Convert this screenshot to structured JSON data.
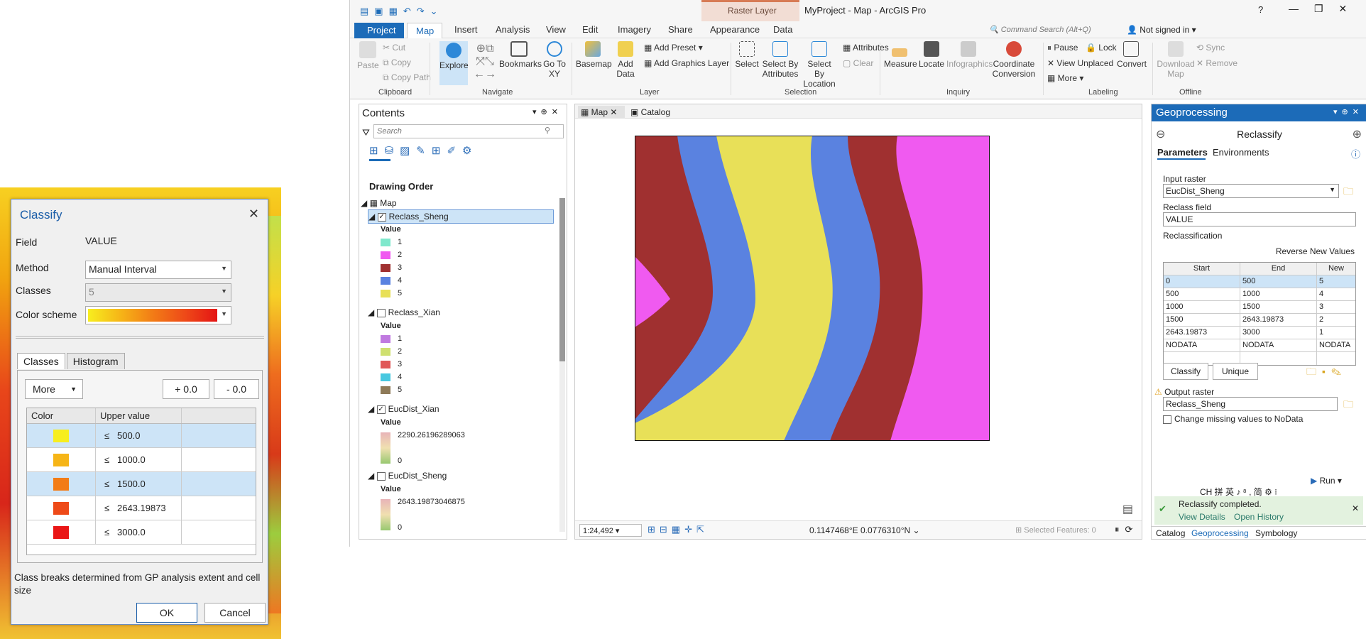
{
  "classify": {
    "title": "Classify",
    "field_label": "Field",
    "field_value": "VALUE",
    "method_label": "Method",
    "method_value": "Manual Interval",
    "classes_label": "Classes",
    "classes_value": "5",
    "color_scheme_label": "Color scheme",
    "tabs": [
      "Classes",
      "Histogram"
    ],
    "more_label": "More",
    "plus_label": "+ 0.0",
    "minus_label": "- 0.0",
    "col_color": "Color",
    "col_upper": "Upper value",
    "rows": [
      {
        "color": "#f7ee1f",
        "le": "≤",
        "value": "500.0",
        "selected": true
      },
      {
        "color": "#f6b517",
        "le": "≤",
        "value": "1000.0",
        "selected": false
      },
      {
        "color": "#f27c16",
        "le": "≤",
        "value": "1500.0",
        "selected": true
      },
      {
        "color": "#ee4a18",
        "le": "≤",
        "value": "2643.19873",
        "selected": false
      },
      {
        "color": "#ea1616",
        "le": "≤",
        "value": "3000.0",
        "selected": false
      }
    ],
    "note": "Class breaks determined from GP analysis extent and cell size",
    "ok": "OK",
    "cancel": "Cancel"
  },
  "app": {
    "title": "MyProject - Map - ArcGIS Pro",
    "context_tab": "Raster Layer",
    "help": "?",
    "signin": "Not signed in",
    "search_placeholder": "Command Search (Alt+Q)",
    "tabs": [
      "Project",
      "Map",
      "Insert",
      "Analysis",
      "View",
      "Edit",
      "Imagery",
      "Share",
      "Appearance",
      "Data"
    ]
  },
  "ribbon": {
    "clipboard": {
      "paste": "Paste",
      "cut": "Cut",
      "copy": "Copy",
      "copy_path": "Copy Path",
      "group": "Clipboard"
    },
    "navigate": {
      "explore": "Explore",
      "bookmarks": "Bookmarks",
      "goto": "Go To XY",
      "group": "Navigate"
    },
    "layer": {
      "basemap": "Basemap",
      "add_data": "Add Data",
      "add_preset": "Add Preset",
      "add_graphics": "Add Graphics Layer",
      "group": "Layer"
    },
    "selection": {
      "select": "Select",
      "by_attr": "Select By Attributes",
      "by_loc": "Select By Location",
      "attributes": "Attributes",
      "clear": "Clear",
      "group": "Selection"
    },
    "inquiry": {
      "measure": "Measure",
      "locate": "Locate",
      "infographics": "Infographics",
      "coord": "Coordinate Conversion",
      "group": "Inquiry"
    },
    "labeling": {
      "pause": "Pause",
      "lock": "Lock",
      "view_unplaced": "View Unplaced",
      "more": "More",
      "convert": "Convert",
      "group": "Labeling"
    },
    "offline": {
      "download": "Download Map",
      "sync": "Sync",
      "remove": "Remove",
      "group": "Offline"
    }
  },
  "contents": {
    "title": "Contents",
    "search_placeholder": "Search",
    "drawing_order": "Drawing Order",
    "map": "Map",
    "layers": [
      {
        "name": "Reclass_Sheng",
        "checked": true,
        "legend_title": "Value",
        "items": [
          {
            "label": "1",
            "color": "#7fe8cc"
          },
          {
            "label": "2",
            "color": "#f05af0"
          },
          {
            "label": "3",
            "color": "#a03030"
          },
          {
            "label": "4",
            "color": "#5a82e0"
          },
          {
            "label": "5",
            "color": "#e8e058"
          }
        ]
      },
      {
        "name": "Reclass_Xian",
        "checked": false,
        "legend_title": "Value",
        "items": [
          {
            "label": "1",
            "color": "#c07ae0"
          },
          {
            "label": "2",
            "color": "#cfe070"
          },
          {
            "label": "3",
            "color": "#e05858"
          },
          {
            "label": "4",
            "color": "#48c8e0"
          },
          {
            "label": "5",
            "color": "#8e7a58"
          }
        ]
      },
      {
        "name": "EucDist_Xian",
        "checked": true,
        "legend_title": "Value",
        "high": "2290.26196289063",
        "low": "0"
      },
      {
        "name": "EucDist_Sheng",
        "checked": false,
        "legend_title": "Value",
        "high": "2643.19873046875",
        "low": "0"
      }
    ]
  },
  "mapview": {
    "tab_map": "Map",
    "tab_catalog": "Catalog",
    "scale": "1:24,492",
    "coords": "0.1147468°E 0.0776310°N",
    "selected": "Selected Features: 0"
  },
  "geo": {
    "title": "Geoprocessing",
    "tool": "Reclassify",
    "tab_params": "Parameters",
    "tab_env": "Environments",
    "input_label": "Input raster",
    "input_value": "EucDist_Sheng",
    "field_label": "Reclass field",
    "field_value": "VALUE",
    "reclass_label": "Reclassification",
    "reverse": "Reverse New Values",
    "headers": [
      "Start",
      "End",
      "New"
    ],
    "rows": [
      [
        "0",
        "500",
        "5"
      ],
      [
        "500",
        "1000",
        "4"
      ],
      [
        "1000",
        "1500",
        "3"
      ],
      [
        "1500",
        "2643.19873",
        "2"
      ],
      [
        "2643.19873",
        "3000",
        "1"
      ],
      [
        "NODATA",
        "NODATA",
        "NODATA"
      ]
    ],
    "classify_btn": "Classify",
    "unique_btn": "Unique",
    "output_label": "Output raster",
    "output_value": "Reclass_Sheng",
    "missing_label": "Change missing values to NoData",
    "run": "Run",
    "ime": "CH 拼 英 ♪ ⁸ , 简 ⚙ ⁝",
    "completed": "Reclassify completed.",
    "view_details": "View Details",
    "open_history": "Open History",
    "bottom_tabs": [
      "Catalog",
      "Geoprocessing",
      "Symbology"
    ]
  }
}
